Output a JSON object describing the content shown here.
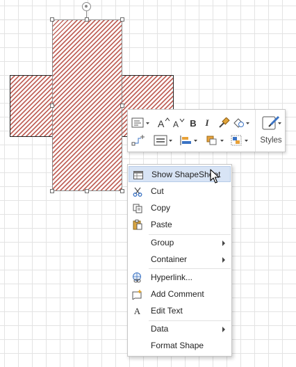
{
  "mini_toolbar": {
    "styles_label": "Styles"
  },
  "context_menu": {
    "items": [
      {
        "label": "Show ShapeSheet",
        "icon": "shapesheet-icon",
        "highlighted": true
      },
      {
        "label": "Cut",
        "icon": "scissors-icon"
      },
      {
        "label": "Copy",
        "icon": "copy-icon"
      },
      {
        "label": "Paste",
        "icon": "paste-icon"
      },
      {
        "label": "Group",
        "submenu": true
      },
      {
        "label": "Container",
        "submenu": true
      },
      {
        "label": "Hyperlink...",
        "icon": "hyperlink-icon"
      },
      {
        "label": "Add Comment",
        "icon": "add-comment-icon"
      },
      {
        "label": "Edit Text",
        "icon": "edit-text-icon",
        "icon_text": "A"
      },
      {
        "label": "Data",
        "submenu": true
      },
      {
        "label": "Format Shape"
      }
    ]
  },
  "colors": {
    "hatch_stripe": "#c0635a",
    "menu_highlight": "#d8e4f5",
    "grid_line": "#e3e3e3"
  }
}
